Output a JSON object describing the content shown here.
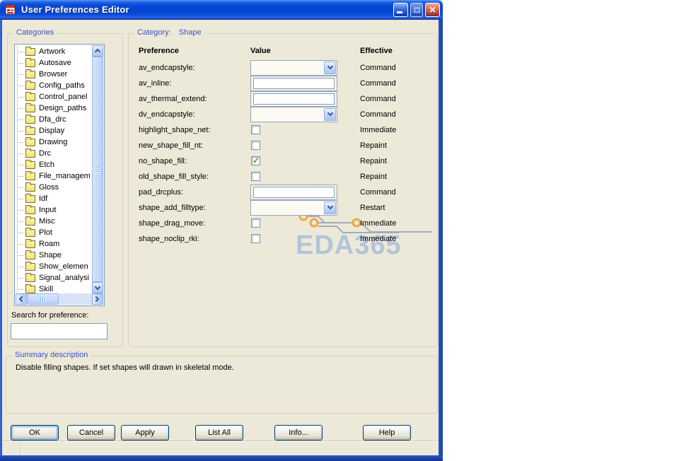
{
  "window": {
    "title": "User Preferences Editor"
  },
  "categories_panel": {
    "group_label": "Categories",
    "item_icon": "folder-icon",
    "tree_items": [
      "Artwork",
      "Autosave",
      "Browser",
      "Config_paths",
      "Control_panel",
      "Design_paths",
      "Dfa_drc",
      "Display",
      "Drawing",
      "Drc",
      "Etch",
      "File_managem",
      "Gloss",
      "Idf",
      "Input",
      "Misc",
      "Plot",
      "Roam",
      "Shape",
      "Show_elemen",
      "Signal_analysi",
      "Skill"
    ],
    "search_label": "Search for preference:",
    "search_value": ""
  },
  "preferences_panel": {
    "group_label_prefix": "Category:",
    "group_label_value": "Shape",
    "columns": [
      "Preference",
      "Value",
      "Effective"
    ],
    "rows": [
      {
        "name": "av_endcapstyle:",
        "control": "combo",
        "value": "",
        "effective": "Command"
      },
      {
        "name": "av_inline:",
        "control": "text",
        "value": "",
        "effective": "Command"
      },
      {
        "name": "av_thermal_extend:",
        "control": "text",
        "value": "",
        "effective": "Command"
      },
      {
        "name": "dv_endcapstyle:",
        "control": "combo",
        "value": "",
        "effective": "Command"
      },
      {
        "name": "highlight_shape_net:",
        "control": "checkbox",
        "checked": false,
        "effective": "Immediate"
      },
      {
        "name": "new_shape_fill_nt:",
        "control": "checkbox",
        "checked": false,
        "effective": "Repaint"
      },
      {
        "name": "no_shape_fill:",
        "control": "checkbox",
        "checked": true,
        "effective": "Repaint"
      },
      {
        "name": "old_shape_fill_style:",
        "control": "checkbox",
        "checked": false,
        "effective": "Repaint"
      },
      {
        "name": "pad_drcplus:",
        "control": "text",
        "value": "",
        "effective": "Command"
      },
      {
        "name": "shape_add_filltype:",
        "control": "combo",
        "value": "",
        "effective": "Restart"
      },
      {
        "name": "shape_drag_move:",
        "control": "checkbox",
        "checked": false,
        "effective": "Immediate"
      },
      {
        "name": "shape_noclip_rki:",
        "control": "checkbox",
        "checked": false,
        "effective": "Immediate"
      }
    ]
  },
  "summary": {
    "group_label": "Summary description",
    "text": "Disable filling shapes. If set shapes will drawn in skeletal mode."
  },
  "footer_buttons": [
    {
      "label": "OK",
      "default": true
    },
    {
      "label": "Cancel",
      "default": false
    },
    {
      "label": "Apply",
      "default": false
    },
    {
      "label": "List All",
      "default": false
    },
    {
      "label": "Info...",
      "default": false
    },
    {
      "label": "Help",
      "default": false
    }
  ],
  "watermark": {
    "text": "EDA365",
    "text_color": "#a9bedb",
    "accent_color": "#f0a83c",
    "trace_color": "#9aa6b8"
  },
  "colors": {
    "dialog_bg": "#ece9d8",
    "titlebar_blue": "#0443cf",
    "group_label_blue": "#3a53c4",
    "check_green": "#4e9c33"
  }
}
